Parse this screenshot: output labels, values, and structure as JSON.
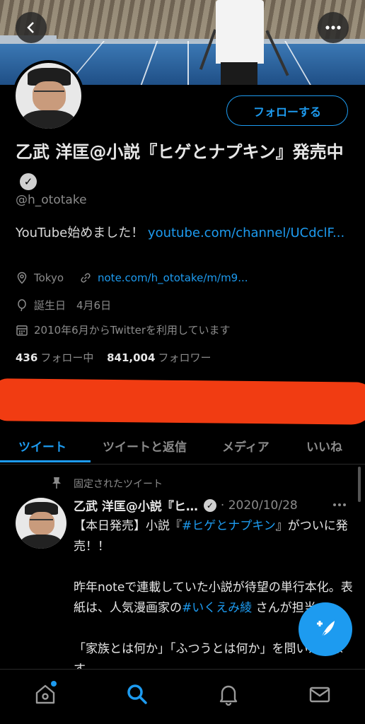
{
  "profile": {
    "display_name": "乙武 洋匡@小説『ヒゲとナプキン』発売中",
    "handle": "@h_ototake",
    "follow_label": "フォローする",
    "bio_text": "YouTube始めました！ ",
    "bio_link": "youtube.com/channel/UCdclF...",
    "location": "Tokyo",
    "website": "note.com/h_ototake/m/m9...",
    "birthday": "誕生日　4月6日",
    "joined": "2010年6月からTwitterを利用しています",
    "following_count": "436",
    "following_label": "フォロー中",
    "followers_count": "841,004",
    "followers_label": "フォロワー"
  },
  "tabs": [
    {
      "label": "ツイート",
      "active": true
    },
    {
      "label": "ツイートと返信",
      "active": false
    },
    {
      "label": "メディア",
      "active": false
    },
    {
      "label": "いいね",
      "active": false
    }
  ],
  "pinned_tweet": {
    "pinned_label": "固定されたツイート",
    "author": "乙武 洋匡@小説『ヒ…",
    "date": "· 2020/10/28",
    "line1_pre": "【本日発売】小説『",
    "line1_hash": "#ヒゲとナプキン",
    "line1_post": "』がついに発売！！",
    "para2_pre": "昨年noteで連載していた小説が待望の単行本化。表紙は、人気漫画家の",
    "para2_hash": "#いくえみ綾",
    "para2_post": " さんが担当。",
    "para3": "「家族とは何か」「ふつうとは何か」を問いかけます"
  },
  "colors": {
    "accent": "#1d9bf0",
    "redaction": "#f13c12",
    "background": "#000000"
  },
  "icons": {
    "back": "back-arrow-icon",
    "more": "more-icon",
    "verified": "verified-badge-icon",
    "location": "location-pin-icon",
    "link": "link-icon",
    "birthday": "balloon-icon",
    "calendar": "calendar-icon",
    "pin": "pin-icon",
    "compose": "compose-feather-icon",
    "home": "home-icon",
    "search": "search-icon",
    "notifications": "bell-icon",
    "messages": "mail-icon"
  }
}
